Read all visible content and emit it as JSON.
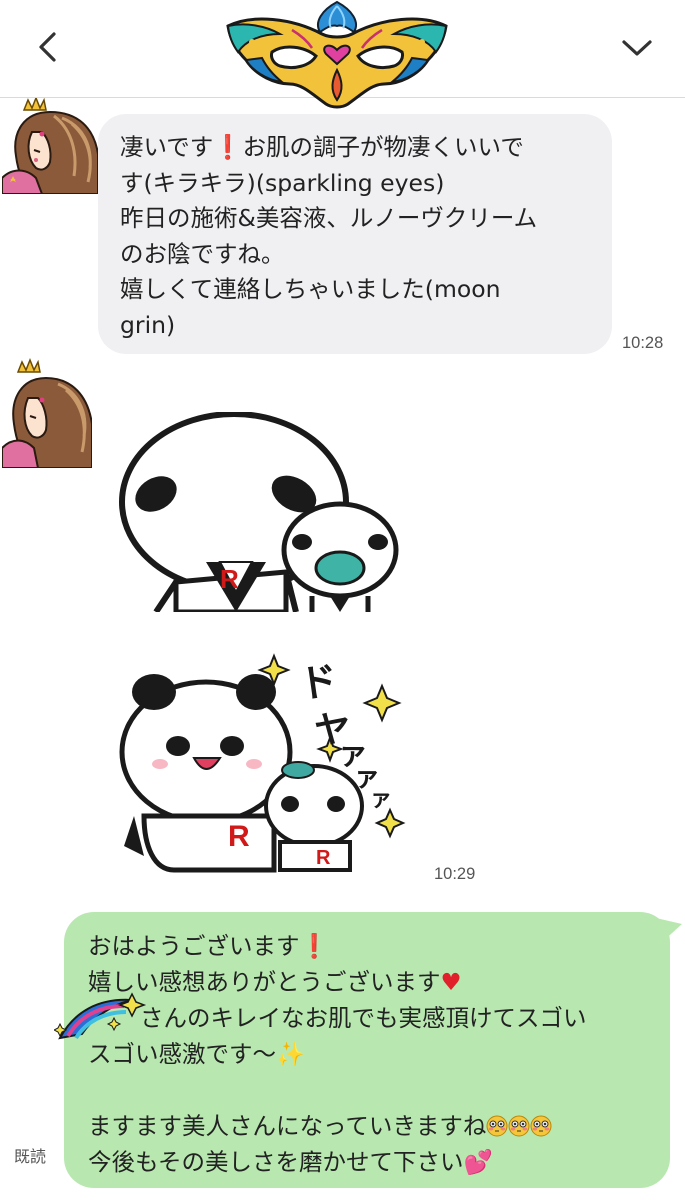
{
  "header": {
    "back_icon": "chevron-left-icon",
    "menu_icon": "chevron-down-icon",
    "logo": "masquerade-mask"
  },
  "messages": {
    "incoming_text": {
      "lines": [
        [
          "凄いです",
          "❗",
          "お肌の調子が物凄くいいで"
        ],
        "す(キラキラ)(sparkling eyes)",
        "昨日の施術&美容液、ルノーヴクリーム",
        "のお陰ですね。",
        "嬉しくて連絡しちゃいました(moon",
        "grin)"
      ],
      "time": "10:28"
    },
    "stickers": {
      "time": "10:29",
      "sticker1_mark": "R",
      "sticker2_text": [
        "ド",
        "ヤ",
        "ァ",
        "ァ",
        "ァ"
      ],
      "sticker2_mark": "R"
    },
    "outgoing_text": {
      "lines": [
        "おはようございます",
        "嬉しい感想ありがとうございます",
        "さんのキレイなお肌でも実感頂けてスゴい",
        "スゴい感激です〜",
        "",
        "ますます美人さんになっていきますね",
        "今後もその美しさを磨かせて下さい"
      ],
      "read": "既読"
    }
  },
  "colors": {
    "incoming_bubble": "#f0f0f3",
    "outgoing_bubble": "#b8e8b0",
    "accent_red": "#e0202a"
  }
}
